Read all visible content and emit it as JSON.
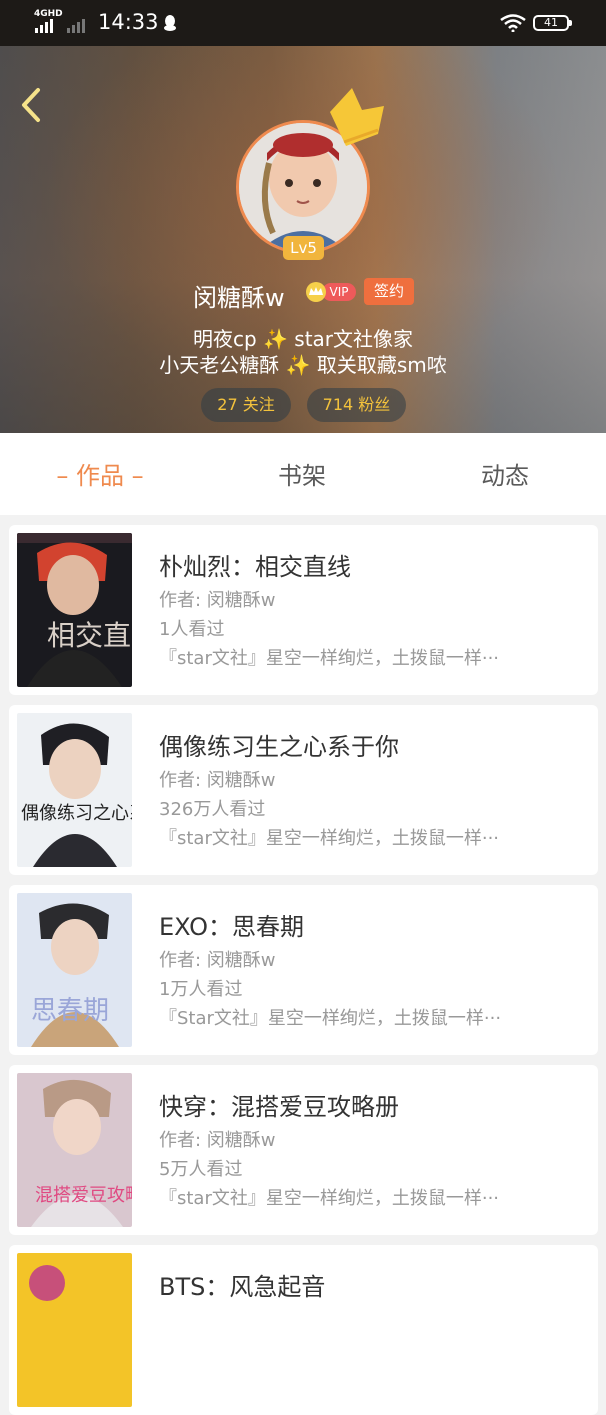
{
  "status_bar": {
    "network": "4GHD",
    "time": "14:33",
    "battery": "41"
  },
  "profile": {
    "level": "Lv5",
    "username": "闵糖酥w",
    "vip_label": "VIP",
    "signed_label": "签约",
    "bio_line_1": "明夜cp ✨ star文社像家",
    "bio_line_2": "小天老公糖酥 ✨ 取关取藏sm哝",
    "following": "27 关注",
    "fans": "714 粉丝"
  },
  "tabs": [
    {
      "label": "– 作品 –",
      "active": true
    },
    {
      "label": "书架",
      "active": false
    },
    {
      "label": "动态",
      "active": false
    }
  ],
  "books": [
    {
      "title": "朴灿烈：相交直线",
      "author": "作者: 闵糖酥w",
      "views": "1人看过",
      "description": "『star文社』星空一样绚烂，土拨鼠一样···",
      "cover_text": "相交直线"
    },
    {
      "title": "偶像练习生之心系于你",
      "author": "作者: 闵糖酥w",
      "views": "326万人看过",
      "description": "『star文社』星空一样绚烂，土拨鼠一样···",
      "cover_text": "偶像练习之心系于你"
    },
    {
      "title": "EXO：思春期",
      "author": "作者: 闵糖酥w",
      "views": "1万人看过",
      "description": "『Star文社』星空一样绚烂，土拨鼠一样···",
      "cover_text": "思春期"
    },
    {
      "title": "快穿：混搭爱豆攻略册",
      "author": "作者: 闵糖酥w",
      "views": "5万人看过",
      "description": "『star文社』星空一样绚烂，土拨鼠一样···",
      "cover_text": "混搭爱豆攻略册"
    },
    {
      "title": "BTS：风急起音",
      "author": "",
      "views": "",
      "description": "",
      "cover_text": ""
    }
  ],
  "colors": {
    "accent": "#ef8a4e",
    "level_badge": "#f1b53d",
    "stat_text": "#f3c23c",
    "vip": "#ee5a5a",
    "signed": "#ef6f3e"
  },
  "icons": [
    "back-arrow-icon",
    "crown-icon",
    "qq-icon",
    "wifi-icon",
    "signal-icon",
    "battery-icon"
  ]
}
